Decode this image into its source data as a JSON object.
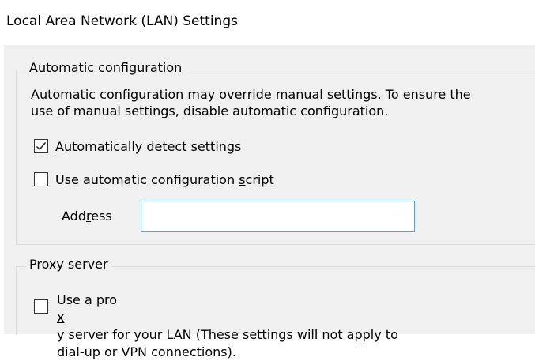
{
  "window": {
    "title": "Local Area Network (LAN) Settings"
  },
  "auto_config": {
    "legend": "Automatic configuration",
    "description_line1": "Automatic configuration may override manual settings.  To ensure the",
    "description_line2": "use of manual settings, disable automatic configuration.",
    "detect_settings": {
      "label_before": "",
      "label_access_key": "A",
      "label_after": "utomatically detect settings",
      "checked": true
    },
    "use_script": {
      "label_before": "Use automatic configuration ",
      "label_access_key": "s",
      "label_after": "cript",
      "checked": false
    },
    "address": {
      "label_before": "Add",
      "label_access_key": "r",
      "label_after": "ess",
      "value": "",
      "placeholder": ""
    }
  },
  "proxy": {
    "legend": "Proxy server",
    "use_proxy": {
      "label_line1_before": "Use a pro",
      "label_access_key": "x",
      "label_line1_after": "y server for your LAN (These settings will not apply to",
      "label_line2": "dial-up or VPN connections).",
      "checked": false
    }
  },
  "colors": {
    "panel_background": "#f0f0f0",
    "input_focus_border": "#5aa0dc",
    "group_border": "#dcdcdc"
  },
  "icons": {
    "checkmark": "checkmark-icon"
  }
}
